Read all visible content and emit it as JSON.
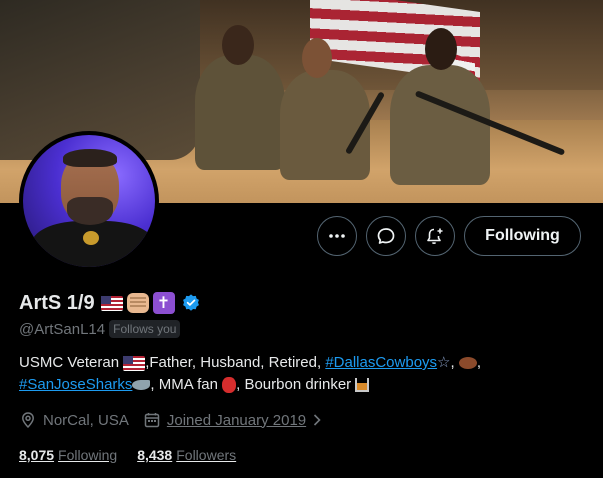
{
  "profile": {
    "name": "ArtS 1/9",
    "handle": "@ArtSanL14",
    "follows_you": "Follows you",
    "verified_color": "#1d9bf0"
  },
  "actions": {
    "more_icon": "more-horizontal-icon",
    "message_icon": "message-icon",
    "notify_icon": "notification-bell-plus-icon",
    "follow_label": "Following"
  },
  "bio": {
    "part1": "USMC Veteran ",
    "part2": ",Father, Husband, Retired, ",
    "hashtag1": "#DallasCowboys",
    "part3": ", ",
    "hashtag2": "#SanJoseSharks",
    "part4": ", MMA fan ",
    "part5": ", Bourbon drinker "
  },
  "meta": {
    "location": "NorCal, USA",
    "joined": "Joined January 2019"
  },
  "stats": {
    "following_count": "8,075",
    "following_label": "Following",
    "followers_count": "8,438",
    "followers_label": "Followers"
  },
  "colors": {
    "background": "#000000",
    "link": "#1d9bf0",
    "muted": "#71767b",
    "border": "#536471"
  }
}
